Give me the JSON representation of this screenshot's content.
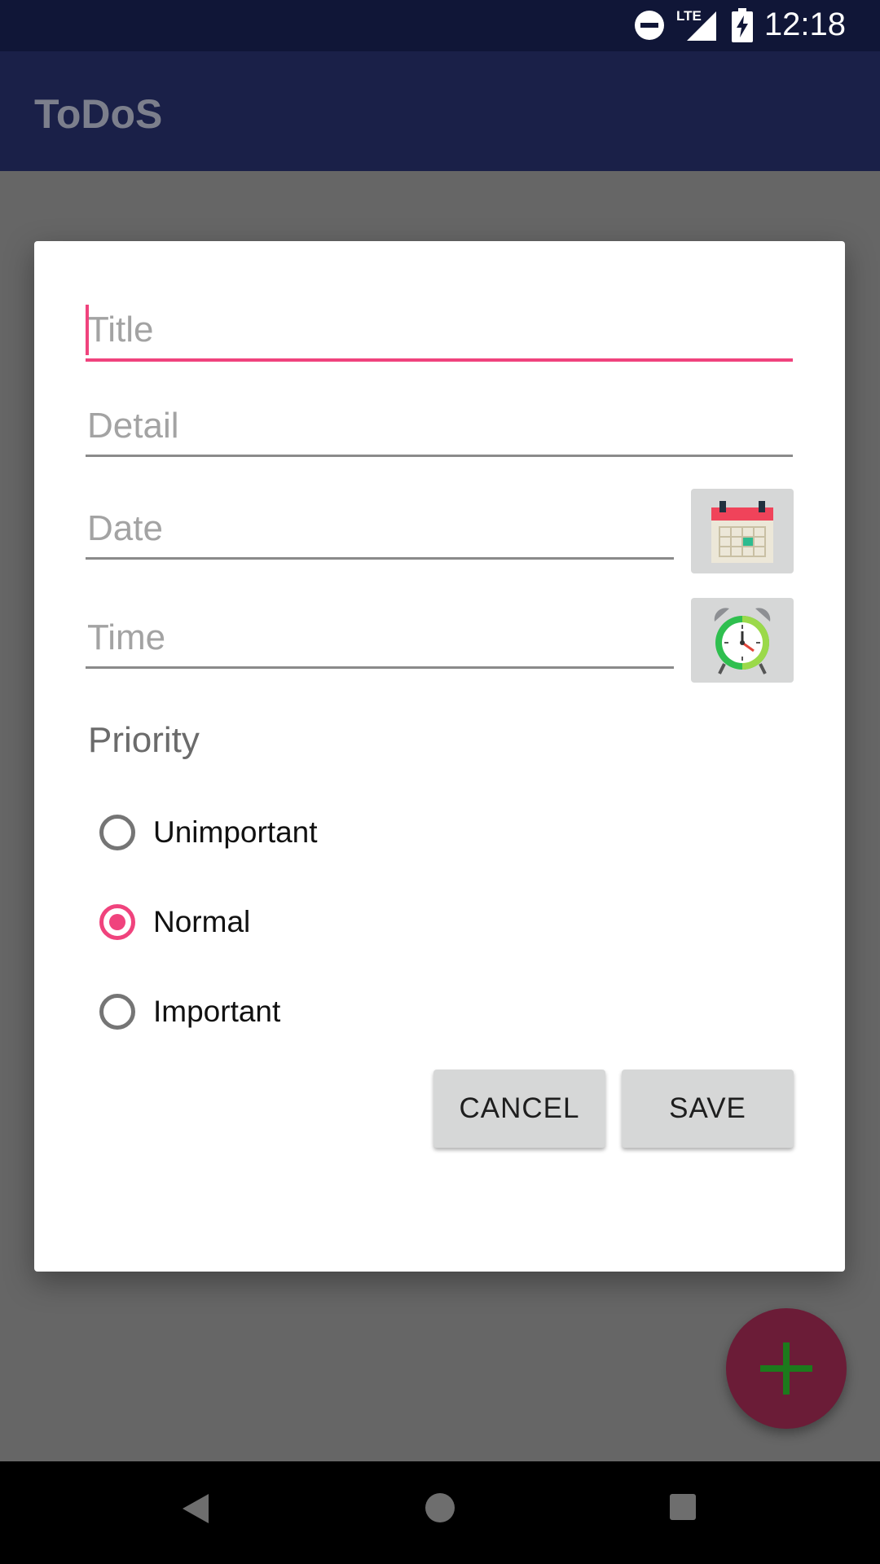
{
  "status_bar": {
    "time": "12:18",
    "network": "LTE"
  },
  "app_bar": {
    "title": "ToDoS"
  },
  "dialog": {
    "title_field": {
      "placeholder": "Title",
      "value": ""
    },
    "detail_field": {
      "placeholder": "Detail",
      "value": ""
    },
    "date_field": {
      "placeholder": "Date",
      "value": ""
    },
    "time_field": {
      "placeholder": "Time",
      "value": ""
    },
    "date_button_icon": "calendar-icon",
    "time_button_icon": "alarm-clock-icon",
    "priority_label": "Priority",
    "priority_options": [
      {
        "label": "Unimportant",
        "checked": false
      },
      {
        "label": "Normal",
        "checked": true
      },
      {
        "label": "Important",
        "checked": false
      }
    ],
    "cancel_label": "CANCEL",
    "save_label": "SAVE"
  },
  "fab_icon": "plus-icon",
  "colors": {
    "accent": "#f0437d",
    "primary_dark": "#101637",
    "primary": "#1a2048",
    "fab": "#6b1c37",
    "fab_icon": "#1c7a1c"
  }
}
